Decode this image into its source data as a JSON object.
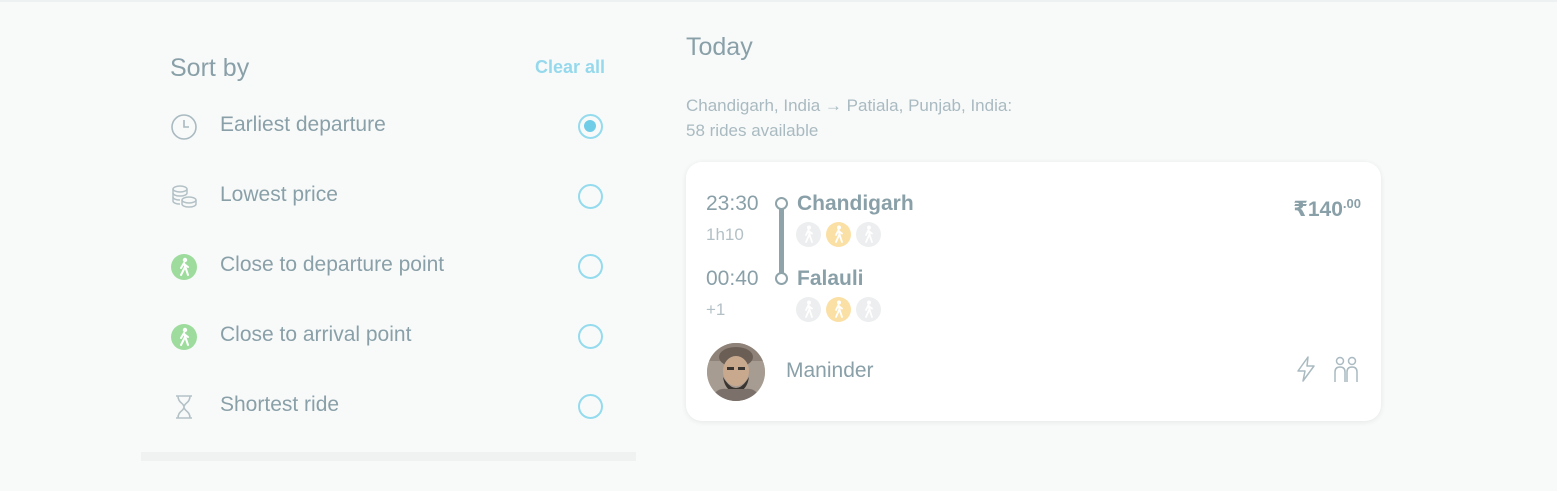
{
  "sort": {
    "title": "Sort by",
    "clear_all": "Clear all",
    "options": [
      {
        "label": "Earliest departure",
        "icon": "clock-icon",
        "selected": true
      },
      {
        "label": "Lowest price",
        "icon": "coins-icon",
        "selected": false
      },
      {
        "label": "Close to departure point",
        "icon": "walking-person-icon",
        "selected": false
      },
      {
        "label": "Close to arrival point",
        "icon": "walking-person-icon",
        "selected": false
      },
      {
        "label": "Shortest ride",
        "icon": "hourglass-icon",
        "selected": false
      }
    ]
  },
  "results": {
    "heading": "Today",
    "route_line": "Chandigarh, India → Patiala, Punjab, India:",
    "count_line": "58 rides available"
  },
  "ride": {
    "departure_time": "23:30",
    "duration": "1h10",
    "arrival_time": "00:40",
    "day_offset": "+1",
    "from_city": "Chandigarh",
    "to_city": "Falauli",
    "price_main": "₹140",
    "price_cents": ".00",
    "driver_name": "Maninder",
    "proximity_from": [
      false,
      true,
      false
    ],
    "proximity_to": [
      false,
      true,
      false
    ]
  },
  "colors": {
    "accent": "#6fcde8",
    "text": "#8aa0a8",
    "walk_active": "#fbe0a6",
    "walk_green": "#9edc9e"
  }
}
